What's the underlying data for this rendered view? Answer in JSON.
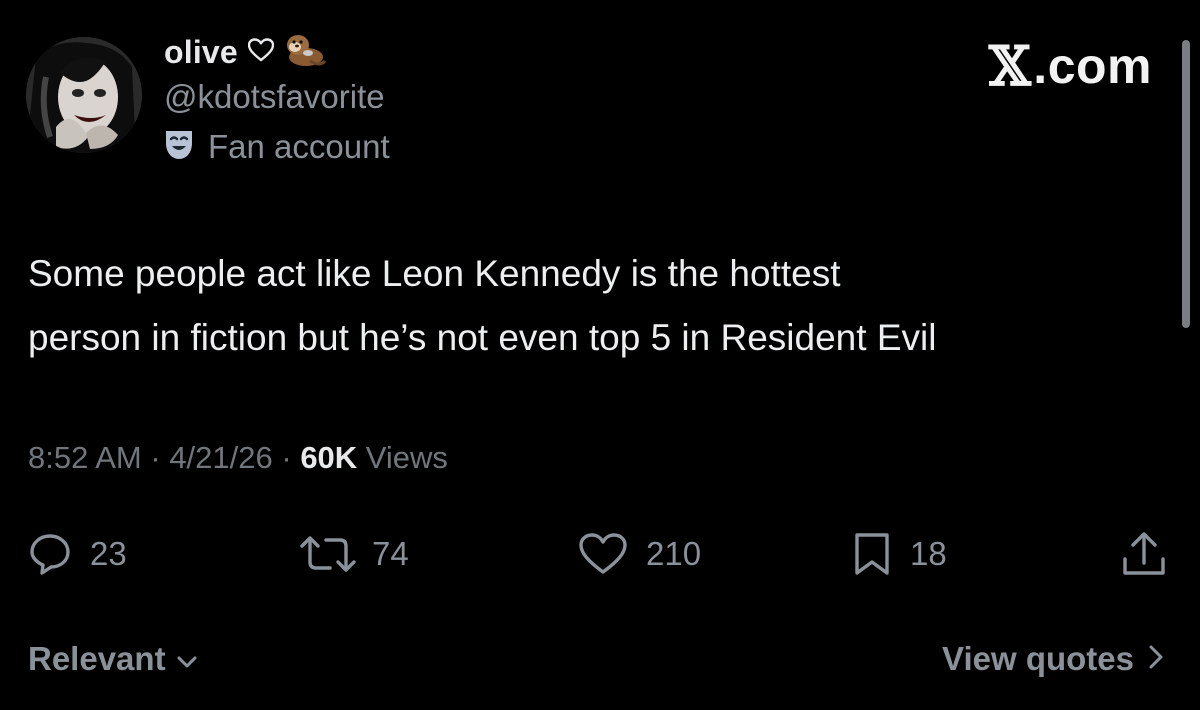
{
  "author": {
    "display_name": "olive",
    "handle": "@kdotsfavorite",
    "label": "Fan account",
    "avatar_icon": "avatar-photo",
    "name_icons": [
      "heart-outline-icon",
      "otter-emoji-icon"
    ],
    "label_icon": "theater-mask-icon"
  },
  "brand": {
    "text": ".com",
    "logo": "x-logo-icon"
  },
  "tweet": {
    "line1": "Some people act like Leon Kennedy is the hottest",
    "line2": "person in fiction but he’s not even top 5 in Resident Evil"
  },
  "meta": {
    "time": "8:52 AM",
    "sep1": " · ",
    "date": "4/21/26",
    "sep2": " · ",
    "views_count": "60K",
    "views_label": " Views"
  },
  "actions": {
    "replies": "23",
    "reposts": "74",
    "likes": "210",
    "bookmarks": "18"
  },
  "footer": {
    "sort_label": "Relevant",
    "quotes_label": "View quotes"
  },
  "colors": {
    "background": "#000000",
    "text_primary": "#e7e9ea",
    "text_secondary": "#71767b"
  }
}
